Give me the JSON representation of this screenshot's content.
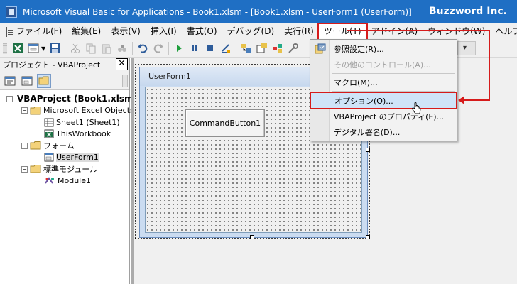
{
  "titlebar": {
    "title": "Microsoft Visual Basic for Applications - Book1.xlsm - [Book1.xlsm - UserForm1 (UserForm)]",
    "brand": "Buzzword Inc."
  },
  "menubar": {
    "items": [
      "ファイル(F)",
      "編集(E)",
      "表示(V)",
      "挿入(I)",
      "書式(O)",
      "デバッグ(D)",
      "実行(R)",
      "ツール(T)",
      "アドイン(A)",
      "ウィンドウ(W)",
      "ヘルプ(H)"
    ],
    "open_item": "ツール(T)"
  },
  "project_panel": {
    "title": "プロジェクト - VBAProject",
    "close_label": "✕",
    "tree": [
      {
        "label": "VBAProject (Book1.xlsm)",
        "level": 0,
        "expander": "−",
        "icon": "vba-project-icon",
        "bold": true
      },
      {
        "label": "Microsoft Excel Objects",
        "level": 1,
        "expander": "−",
        "icon": "folder-icon"
      },
      {
        "label": "Sheet1 (Sheet1)",
        "level": 2,
        "icon": "sheet-icon"
      },
      {
        "label": "ThisWorkbook",
        "level": 2,
        "icon": "workbook-icon"
      },
      {
        "label": "フォーム",
        "level": 1,
        "expander": "−",
        "icon": "folder-icon"
      },
      {
        "label": "UserForm1",
        "level": 2,
        "icon": "userform-icon",
        "selected": true
      },
      {
        "label": "標準モジュール",
        "level": 1,
        "expander": "−",
        "icon": "folder-icon"
      },
      {
        "label": "Module1",
        "level": 2,
        "icon": "module-icon"
      }
    ]
  },
  "designer": {
    "form_title": "UserForm1",
    "button_label": "CommandButton1"
  },
  "tools_menu": {
    "items": [
      {
        "label": "参照設定(R)...",
        "icon": "references-icon",
        "disabled": false
      },
      {
        "label": "その他のコントロール(A)...",
        "disabled": true
      },
      {
        "label": "マクロ(M)...",
        "disabled": false
      },
      {
        "label": "オプション(O)...",
        "disabled": false,
        "highlighted": true
      },
      {
        "label": "VBAProject のプロパティ(E)...",
        "disabled": false
      },
      {
        "label": "デジタル署名(D)...",
        "disabled": false
      }
    ]
  },
  "colors": {
    "titlebar": "#1f6fc4",
    "annotation": "#d61b1b",
    "menu_highlight": "#cfe4f8"
  }
}
